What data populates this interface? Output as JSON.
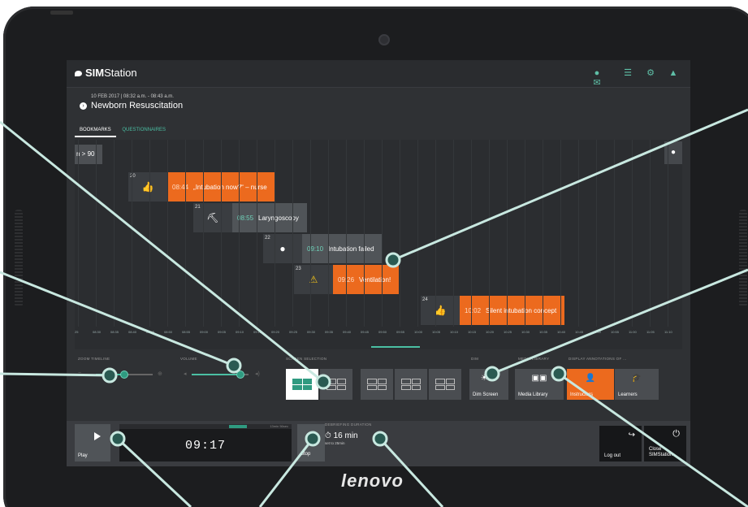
{
  "app": {
    "name_bold": "SIM",
    "name_rest": "Station"
  },
  "session": {
    "date": "10 FEB 2017  |  08:32 a.m. - 08:43 a.m.",
    "title": "Newborn Resuscitation",
    "info_icon": "info-icon"
  },
  "header_icons": [
    "messages-icon",
    "list-icon",
    "settings-icon",
    "user-icon"
  ],
  "tabs": [
    {
      "label": "BOOKMARKS",
      "active": true
    },
    {
      "label": "QUESTIONNAIRES",
      "active": false
    }
  ],
  "timeline": {
    "left_edge": "n > 90",
    "right_edge_icon": "chat-icon",
    "bookmarks": [
      {
        "num": "20",
        "icon": "thumbs-up-icon",
        "time": "08:44",
        "text": "„Intubation now?“ – nurse",
        "style": "orange"
      },
      {
        "num": "21",
        "icon": "laryngoscope-icon",
        "time": "08:55",
        "text": "Laryngoscopy",
        "style": "gray"
      },
      {
        "num": "22",
        "icon": "chat-icon",
        "time": "09:10",
        "text": "Intubation failed",
        "style": "gray"
      },
      {
        "num": "23",
        "icon": "warning-icon",
        "time": "09:26",
        "text": "Ventilation!",
        "style": "orange"
      },
      {
        "num": "24",
        "icon": "thumbs-up-icon",
        "time": "10:02",
        "text": "Silent intubation concept",
        "style": "orange"
      }
    ],
    "ticks": [
      "25",
      "08:30",
      "08:35",
      "08:40",
      "08:45",
      "08:50",
      "08:55",
      "09:00",
      "09:05",
      "09:10",
      "09:15",
      "09:20",
      "09:25",
      "09:30",
      "09:35",
      "09:40",
      "09:45",
      "09:50",
      "09:55",
      "10:00",
      "10:05",
      "10:10",
      "10:15",
      "10:20",
      "10:25",
      "10:30",
      "10:35",
      "10:40",
      "10:45",
      "10:50",
      "10:55",
      "11:00",
      "11:05",
      "11:10"
    ]
  },
  "controls": {
    "zoom_label": "ZOOM TIMELINE",
    "zoom_level": 0.5,
    "volume_label": "VOLUME",
    "volume_level": 0.85,
    "screen_selection_label": "SCREEN SELECTION",
    "dim_label": "DIM",
    "media_library_label": "MEDIA LIBRARY",
    "annotations_label": "DISPLAY ANNOTATIONS OF ...",
    "dim_button": "Dim Screen",
    "media_button": "Media Library",
    "instructors_button": "Instructors",
    "learners_button": "Learners"
  },
  "bottom": {
    "play": "Play",
    "time": "09:17",
    "remaining": "13min 56sec",
    "stop": "Stop",
    "debrief_label": "DEBRIEFING DURATION",
    "debrief_value": "16 min",
    "debrief_sub": "set to 25min",
    "logout": "Log out",
    "close": "Close SIMStation"
  },
  "device_brand": "lenovo",
  "colors": {
    "accent": "#4bbfa3",
    "orange": "#ec6a1e",
    "screen_bg": "#2f3134"
  }
}
